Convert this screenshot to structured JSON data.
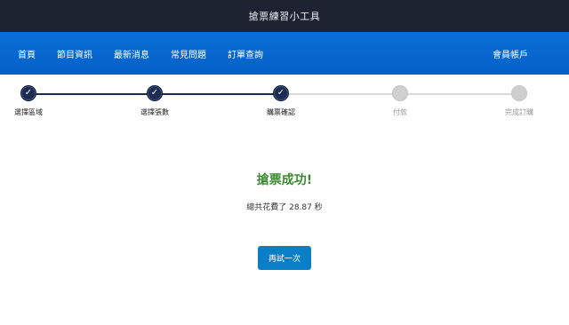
{
  "app": {
    "title": "搶票練習小工具"
  },
  "nav": {
    "items": [
      {
        "label": "首頁"
      },
      {
        "label": "節目資訊"
      },
      {
        "label": "最新消息"
      },
      {
        "label": "常見問題"
      },
      {
        "label": "訂單查詢"
      }
    ],
    "account_label": "會員帳戶"
  },
  "stepper": {
    "steps": [
      {
        "label": "選擇區域",
        "status": "done",
        "icon": "check-icon"
      },
      {
        "label": "選擇張數",
        "status": "done",
        "icon": "check-icon"
      },
      {
        "label": "購票確認",
        "status": "done",
        "icon": "check-icon"
      },
      {
        "label": "付款",
        "status": "pending"
      },
      {
        "label": "完成訂購",
        "status": "pending"
      }
    ],
    "check_glyph": "✓"
  },
  "result": {
    "title": "搶票成功!",
    "time_text": "總共花費了 28.87 秒"
  },
  "retry": {
    "label": "再試一次"
  },
  "colors": {
    "topbar": "#1d2330",
    "nav": "#0a6ed6",
    "step_done": "#1c2b4f",
    "step_pending": "#cfcfcf",
    "success_text": "#3a8a2f",
    "button": "#0a7ec7"
  }
}
